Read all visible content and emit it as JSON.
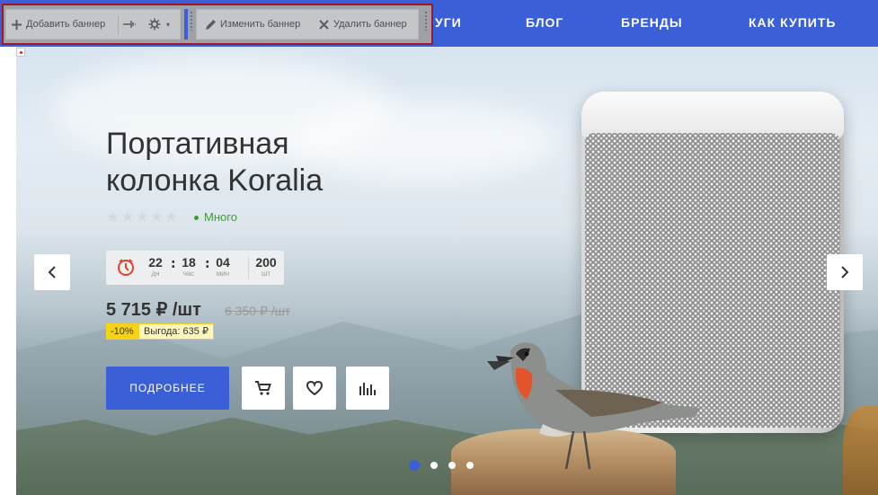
{
  "nav": {
    "items": [
      "УГИ",
      "БЛОГ",
      "БРЕНДЫ",
      "КАК КУПИТЬ"
    ]
  },
  "toolbar": {
    "add_banner": "Добавить баннер",
    "edit_banner": "Изменить баннер",
    "delete_banner": "Удалить баннер"
  },
  "banner": {
    "title_line1": "Портативная",
    "title_line2": "колонка Koralia",
    "stars": "★★★★★",
    "rating": 0,
    "stock": "Много",
    "timer": {
      "days": "22",
      "days_label": "дн",
      "hours": "18",
      "hours_label": "час",
      "minutes": "04",
      "minutes_label": "мин",
      "qty": "200",
      "qty_label": "шт"
    },
    "price": "5 715 ₽ /шт",
    "old_price": "6 350 ₽ /шт",
    "discount": "-10%",
    "savings": "Выгода: 635 ₽",
    "more_button": "ПОДРОБНЕЕ",
    "slides_count": 4,
    "active_slide": 1
  },
  "colors": {
    "accent": "#3b5fd6",
    "stock_green": "#3e9c36",
    "discount_yellow": "#f7d21a",
    "toolbar_border": "#a01828"
  },
  "icons": {
    "add": "plus-icon",
    "pin": "pin-icon",
    "settings": "gear-icon",
    "edit": "pencil-icon",
    "delete": "close-icon",
    "cart": "cart-icon",
    "favorite": "heart-icon",
    "compare": "bar-chart-icon",
    "prev": "chevron-left-icon",
    "next": "chevron-right-icon",
    "timer": "clock-icon"
  }
}
